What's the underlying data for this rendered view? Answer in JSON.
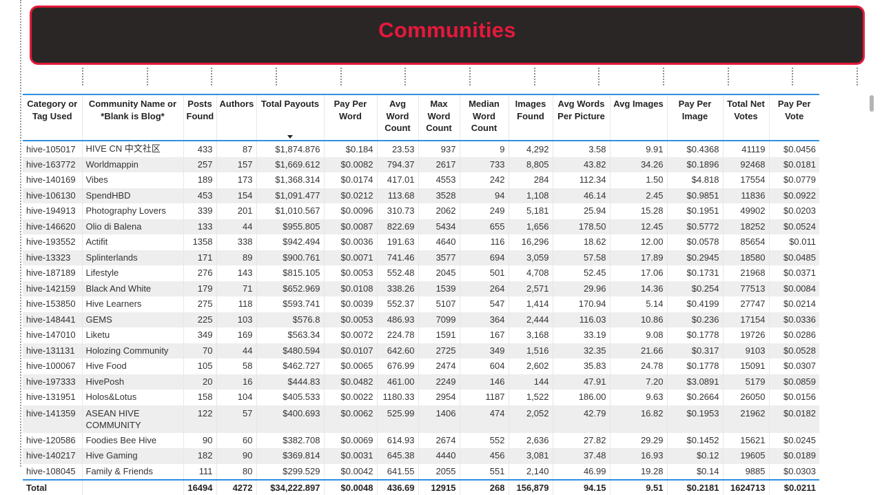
{
  "title": "Communities",
  "columns": [
    "Category or Tag Used",
    "Community Name or *Blank is Blog*",
    "Posts Found",
    "Authors",
    "Total Payouts",
    "Pay Per Word",
    "Avg Word Count",
    "Max Word Count",
    "Median Word Count",
    "Images Found",
    "Avg Words Per Picture",
    "Avg Images",
    "Pay Per Image",
    "Total Net Votes",
    "Pay Per Vote"
  ],
  "sorted_column": "Total Payouts",
  "sort_direction": "descending",
  "rows": [
    [
      "hive-105017",
      "HIVE CN 中文社区",
      "433",
      "87",
      "$1,874.876",
      "$0.184",
      "23.53",
      "937",
      "9",
      "4,292",
      "3.58",
      "9.91",
      "$0.4368",
      "41119",
      "$0.0456"
    ],
    [
      "hive-163772",
      "Worldmappin",
      "257",
      "157",
      "$1,669.612",
      "$0.0082",
      "794.37",
      "2617",
      "733",
      "8,805",
      "43.82",
      "34.26",
      "$0.1896",
      "92468",
      "$0.0181"
    ],
    [
      "hive-140169",
      "Vibes",
      "189",
      "173",
      "$1,368.314",
      "$0.0174",
      "417.01",
      "4553",
      "242",
      "284",
      "112.34",
      "1.50",
      "$4.818",
      "17554",
      "$0.0779"
    ],
    [
      "hive-106130",
      "SpendHBD",
      "453",
      "154",
      "$1,091.477",
      "$0.0212",
      "113.68",
      "3528",
      "94",
      "1,108",
      "46.14",
      "2.45",
      "$0.9851",
      "11836",
      "$0.0922"
    ],
    [
      "hive-194913",
      "Photography Lovers",
      "339",
      "201",
      "$1,010.567",
      "$0.0096",
      "310.73",
      "2062",
      "249",
      "5,181",
      "25.94",
      "15.28",
      "$0.1951",
      "49902",
      "$0.0203"
    ],
    [
      "hive-146620",
      "Olio di Balena",
      "133",
      "44",
      "$955.805",
      "$0.0087",
      "822.69",
      "5434",
      "655",
      "1,656",
      "178.50",
      "12.45",
      "$0.5772",
      "18252",
      "$0.0524"
    ],
    [
      "hive-193552",
      "Actifit",
      "1358",
      "338",
      "$942.494",
      "$0.0036",
      "191.63",
      "4640",
      "116",
      "16,296",
      "18.62",
      "12.00",
      "$0.0578",
      "85654",
      "$0.011"
    ],
    [
      "hive-13323",
      "Splinterlands",
      "171",
      "89",
      "$900.761",
      "$0.0071",
      "741.46",
      "3577",
      "694",
      "3,059",
      "57.58",
      "17.89",
      "$0.2945",
      "18580",
      "$0.0485"
    ],
    [
      "hive-187189",
      "Lifestyle",
      "276",
      "143",
      "$815.105",
      "$0.0053",
      "552.48",
      "2045",
      "501",
      "4,708",
      "52.45",
      "17.06",
      "$0.1731",
      "21968",
      "$0.0371"
    ],
    [
      "hive-142159",
      "Black And White",
      "179",
      "71",
      "$652.969",
      "$0.0108",
      "338.26",
      "1539",
      "264",
      "2,571",
      "29.96",
      "14.36",
      "$0.254",
      "77513",
      "$0.0084"
    ],
    [
      "hive-153850",
      "Hive Learners",
      "275",
      "118",
      "$593.741",
      "$0.0039",
      "552.37",
      "5107",
      "547",
      "1,414",
      "170.94",
      "5.14",
      "$0.4199",
      "27747",
      "$0.0214"
    ],
    [
      "hive-148441",
      "GEMS",
      "225",
      "103",
      "$576.8",
      "$0.0053",
      "486.93",
      "7099",
      "364",
      "2,444",
      "116.03",
      "10.86",
      "$0.236",
      "17154",
      "$0.0336"
    ],
    [
      "hive-147010",
      "Liketu",
      "349",
      "169",
      "$563.34",
      "$0.0072",
      "224.78",
      "1591",
      "167",
      "3,168",
      "33.19",
      "9.08",
      "$0.1778",
      "19726",
      "$0.0286"
    ],
    [
      "hive-131131",
      "Holozing Community",
      "70",
      "44",
      "$480.594",
      "$0.0107",
      "642.60",
      "2725",
      "349",
      "1,516",
      "32.35",
      "21.66",
      "$0.317",
      "9103",
      "$0.0528"
    ],
    [
      "hive-100067",
      "Hive Food",
      "105",
      "58",
      "$462.727",
      "$0.0065",
      "676.99",
      "2474",
      "604",
      "2,602",
      "35.83",
      "24.78",
      "$0.1778",
      "15091",
      "$0.0307"
    ],
    [
      "hive-197333",
      "HivePosh",
      "20",
      "16",
      "$444.83",
      "$0.0482",
      "461.00",
      "2249",
      "146",
      "144",
      "47.91",
      "7.20",
      "$3.0891",
      "5179",
      "$0.0859"
    ],
    [
      "hive-131951",
      "Holos&Lotus",
      "158",
      "104",
      "$405.533",
      "$0.0022",
      "1180.33",
      "2954",
      "1187",
      "1,522",
      "186.00",
      "9.63",
      "$0.2664",
      "26050",
      "$0.0156"
    ],
    [
      "hive-141359",
      "ASEAN HIVE COMMUNITY",
      "122",
      "57",
      "$400.693",
      "$0.0062",
      "525.99",
      "1406",
      "474",
      "2,052",
      "42.79",
      "16.82",
      "$0.1953",
      "21962",
      "$0.0182"
    ],
    [
      "hive-120586",
      "Foodies Bee Hive",
      "90",
      "60",
      "$382.708",
      "$0.0069",
      "614.93",
      "2674",
      "552",
      "2,636",
      "27.82",
      "29.29",
      "$0.1452",
      "15621",
      "$0.0245"
    ],
    [
      "hive-140217",
      "Hive Gaming",
      "182",
      "90",
      "$369.814",
      "$0.0031",
      "645.38",
      "4440",
      "456",
      "3,081",
      "37.48",
      "16.93",
      "$0.12",
      "19605",
      "$0.0189"
    ],
    [
      "hive-108045",
      "Family & Friends",
      "111",
      "80",
      "$299.529",
      "$0.0042",
      "641.55",
      "2055",
      "551",
      "2,140",
      "46.99",
      "19.28",
      "$0.14",
      "9885",
      "$0.0303"
    ]
  ],
  "total": [
    "Total",
    "",
    "16494",
    "4272",
    "$34,222.897",
    "$0.0048",
    "436.69",
    "12915",
    "268",
    "156,879",
    "94.15",
    "9.51",
    "$0.2181",
    "1624713",
    "$0.0211"
  ]
}
